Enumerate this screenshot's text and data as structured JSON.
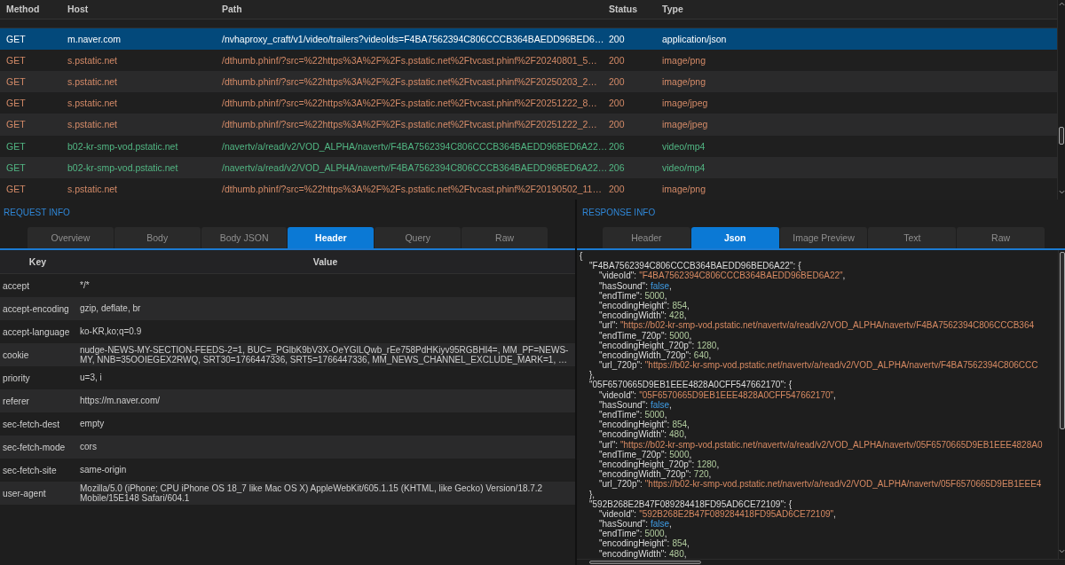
{
  "requests_table": {
    "columns": [
      "Method",
      "Host",
      "Path",
      "Status",
      "Type"
    ],
    "rows": [
      {
        "method": "GET",
        "host": "m.naver.com",
        "path": "/nvhaproxy_craft/v1/video/trailers?videoIds=F4BA7562394C806CCCB364BAEDD96BED6…",
        "status": "200",
        "type": "application/json",
        "color": "#ffffff",
        "selected": true
      },
      {
        "method": "GET",
        "host": "s.pstatic.net",
        "path": "/dthumb.phinf/?src=%22https%3A%2F%2Fs.pstatic.net%2Ftvcast.phinf%2F20240801_5…",
        "status": "200",
        "type": "image/png",
        "color": "#d58b68",
        "selected": false
      },
      {
        "method": "GET",
        "host": "s.pstatic.net",
        "path": "/dthumb.phinf/?src=%22https%3A%2F%2Fs.pstatic.net%2Ftvcast.phinf%2F20250203_2…",
        "status": "200",
        "type": "image/png",
        "color": "#d58b68",
        "selected": false
      },
      {
        "method": "GET",
        "host": "s.pstatic.net",
        "path": "/dthumb.phinf/?src=%22https%3A%2F%2Fs.pstatic.net%2Ftvcast.phinf%2F20251222_8…",
        "status": "200",
        "type": "image/jpeg",
        "color": "#d58b68",
        "selected": false
      },
      {
        "method": "GET",
        "host": "s.pstatic.net",
        "path": "/dthumb.phinf/?src=%22https%3A%2F%2Fs.pstatic.net%2Ftvcast.phinf%2F20251222_2…",
        "status": "200",
        "type": "image/jpeg",
        "color": "#d58b68",
        "selected": false
      },
      {
        "method": "GET",
        "host": "b02-kr-smp-vod.pstatic.net",
        "path": "/navertv/a/read/v2/VOD_ALPHA/navertv/F4BA7562394C806CCCB364BAEDD96BED6A22…",
        "status": "206",
        "type": "video/mp4",
        "color": "#52b784",
        "selected": false
      },
      {
        "method": "GET",
        "host": "b02-kr-smp-vod.pstatic.net",
        "path": "/navertv/a/read/v2/VOD_ALPHA/navertv/F4BA7562394C806CCCB364BAEDD96BED6A22…",
        "status": "206",
        "type": "video/mp4",
        "color": "#52b784",
        "selected": false
      },
      {
        "method": "GET",
        "host": "s.pstatic.net",
        "path": "/dthumb.phinf/?src=%22https%3A%2F%2Fs.pstatic.net%2Ftvcast.phinf%2F20190502_11…",
        "status": "200",
        "type": "image/png",
        "color": "#d58b68",
        "selected": false
      }
    ]
  },
  "request_info": {
    "title": "REQUEST INFO",
    "tabs": [
      {
        "label": "Overview",
        "selected": false
      },
      {
        "label": "Body",
        "selected": false
      },
      {
        "label": "Body JSON",
        "selected": false
      },
      {
        "label": "Header",
        "selected": true
      },
      {
        "label": "Query",
        "selected": false
      },
      {
        "label": "Raw",
        "selected": false
      }
    ],
    "header_table": {
      "columns": [
        "Key",
        "Value"
      ],
      "rows": [
        {
          "key": "accept",
          "value": "*/*"
        },
        {
          "key": "accept-encoding",
          "value": "gzip, deflate, br"
        },
        {
          "key": "accept-language",
          "value": "ko-KR,ko;q=0.9"
        },
        {
          "key": "cookie",
          "value": "nudge-NEWS-MY-SECTION-FEEDS-2=1, BUC=_PGlbK9bV3X-OeYGILQwb_rEe758PdHKiyv95RGBHI4=, MM_PF=NEWS-MY, NNB=35OOIEGEX2RWQ, SRT30=1766447336, SRT5=1766447336, MM_NEWS_CHANNEL_EXCLUDE_MARK=1, …"
        },
        {
          "key": "priority",
          "value": "u=3, i"
        },
        {
          "key": "referer",
          "value": "https://m.naver.com/"
        },
        {
          "key": "sec-fetch-dest",
          "value": "empty"
        },
        {
          "key": "sec-fetch-mode",
          "value": "cors"
        },
        {
          "key": "sec-fetch-site",
          "value": "same-origin"
        },
        {
          "key": "user-agent",
          "value": "Mozilla/5.0 (iPhone; CPU iPhone OS 18_7 like Mac OS X) AppleWebKit/605.1.15 (KHTML, like Gecko) Version/18.7.2 Mobile/15E148 Safari/604.1"
        }
      ]
    }
  },
  "response_info": {
    "title": "RESPONSE INFO",
    "tabs": [
      {
        "label": "Header",
        "selected": false
      },
      {
        "label": "Json",
        "selected": true
      },
      {
        "label": "Image Preview",
        "selected": false
      },
      {
        "label": "Text",
        "selected": false
      },
      {
        "label": "Raw",
        "selected": false
      }
    ],
    "json_view": {
      "root": {
        "value": "{",
        "kind": "object",
        "children": [
          {
            "key": "\"F4BA7562394C806CCCB364BAEDD96BED6A22\":",
            "value": "{",
            "kind": "object",
            "close": "},",
            "children": [
              {
                "key": "\"videoId\":",
                "value": "\"F4BA7562394C806CCCB364BAEDD96BED6A22\"",
                "kind": "string",
                "end": ","
              },
              {
                "key": "\"hasSound\":",
                "value": "false",
                "kind": "boolean",
                "end": ","
              },
              {
                "key": "\"endTime\":",
                "value": "5000",
                "kind": "number",
                "end": ","
              },
              {
                "key": "\"encodingHeight\":",
                "value": "854",
                "kind": "number",
                "end": ","
              },
              {
                "key": "\"encodingWidth\":",
                "value": "428",
                "kind": "number",
                "end": ","
              },
              {
                "key": "\"url\":",
                "value": "\"https://b02-kr-smp-vod.pstatic.net/navertv/a/read/v2/VOD_ALPHA/navertv/F4BA7562394C806CCCB364",
                "kind": "string"
              },
              {
                "key": "\"endTime_720p\":",
                "value": "5000",
                "kind": "number",
                "end": ","
              },
              {
                "key": "\"encodingHeight_720p\":",
                "value": "1280",
                "kind": "number",
                "end": ","
              },
              {
                "key": "\"encodingWidth_720p\":",
                "value": "640",
                "kind": "number",
                "end": ","
              },
              {
                "key": "\"url_720p\":",
                "value": "\"https://b02-kr-smp-vod.pstatic.net/navertv/a/read/v2/VOD_ALPHA/navertv/F4BA7562394C806CCC",
                "kind": "string"
              }
            ]
          },
          {
            "key": "\"05F6570665D9EB1EEE4828A0CFF547662170\":",
            "value": "{",
            "kind": "object",
            "close": "},",
            "children": [
              {
                "key": "\"videoId\":",
                "value": "\"05F6570665D9EB1EEE4828A0CFF547662170\"",
                "kind": "string",
                "end": ","
              },
              {
                "key": "\"hasSound\":",
                "value": "false",
                "kind": "boolean",
                "end": ","
              },
              {
                "key": "\"endTime\":",
                "value": "5000",
                "kind": "number",
                "end": ","
              },
              {
                "key": "\"encodingHeight\":",
                "value": "854",
                "kind": "number",
                "end": ","
              },
              {
                "key": "\"encodingWidth\":",
                "value": "480",
                "kind": "number",
                "end": ","
              },
              {
                "key": "\"url\":",
                "value": "\"https://b02-kr-smp-vod.pstatic.net/navertv/a/read/v2/VOD_ALPHA/navertv/05F6570665D9EB1EEE4828A0",
                "kind": "string"
              },
              {
                "key": "\"endTime_720p\":",
                "value": "5000",
                "kind": "number",
                "end": ","
              },
              {
                "key": "\"encodingHeight_720p\":",
                "value": "1280",
                "kind": "number",
                "end": ","
              },
              {
                "key": "\"encodingWidth_720p\":",
                "value": "720",
                "kind": "number",
                "end": ","
              },
              {
                "key": "\"url_720p\":",
                "value": "\"https://b02-kr-smp-vod.pstatic.net/navertv/a/read/v2/VOD_ALPHA/navertv/05F6570665D9EB1EEE4",
                "kind": "string"
              }
            ]
          },
          {
            "key": "\"592B268E2B47F089284418FD95AD6CE72109\":",
            "value": "{",
            "kind": "object",
            "children": [
              {
                "key": "\"videoId\":",
                "value": "\"592B268E2B47F089284418FD95AD6CE72109\"",
                "kind": "string",
                "end": ","
              },
              {
                "key": "\"hasSound\":",
                "value": "false",
                "kind": "boolean",
                "end": ","
              },
              {
                "key": "\"endTime\":",
                "value": "5000",
                "kind": "number",
                "end": ","
              },
              {
                "key": "\"encodingHeight\":",
                "value": "854",
                "kind": "number",
                "end": ","
              },
              {
                "key": "\"encodingWidth\":",
                "value": "480",
                "kind": "number",
                "end": ","
              }
            ]
          }
        ]
      }
    }
  }
}
